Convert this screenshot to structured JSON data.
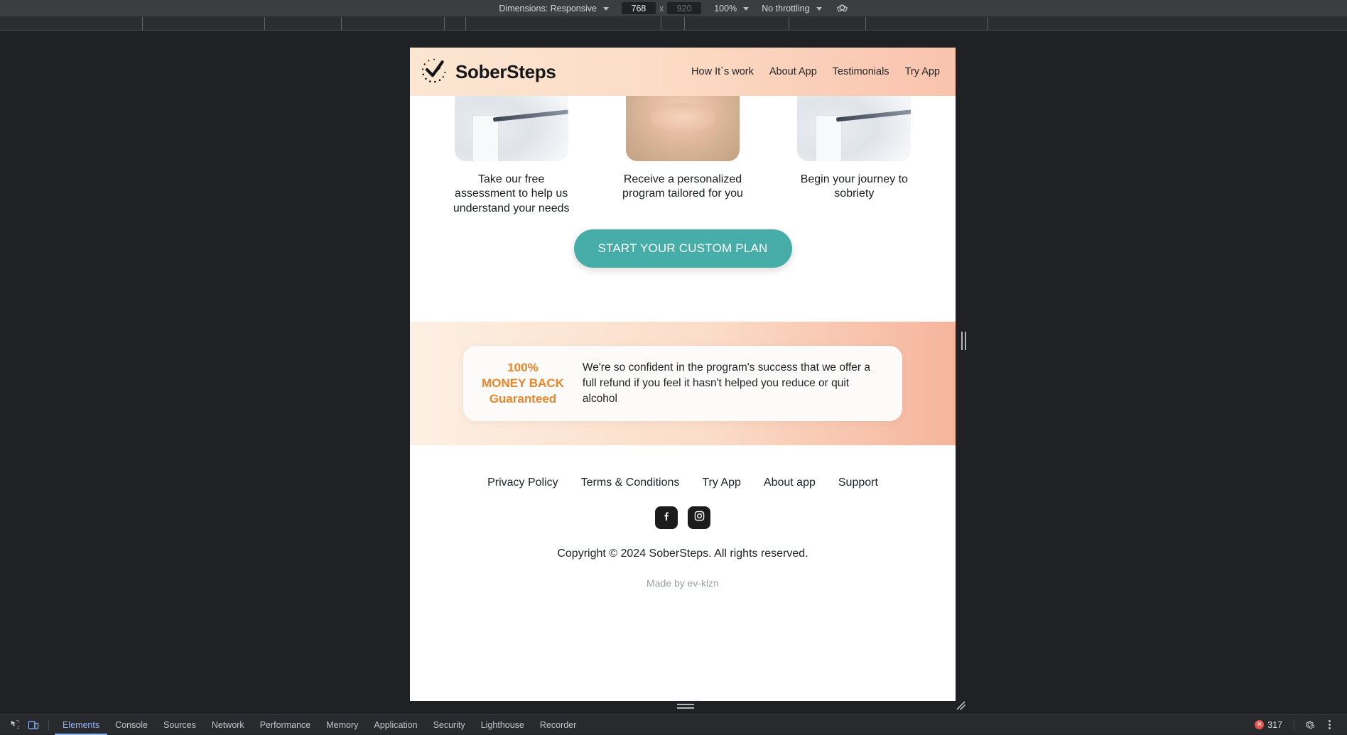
{
  "devtools_toolbar": {
    "dimensions_label": "Dimensions: Responsive",
    "width_value": "768",
    "height_placeholder": "920",
    "x_separator": "x",
    "zoom_label": "100%",
    "throttling_label": "No throttling",
    "rotate_icon": "rotate-icon"
  },
  "ruler": {
    "ticks": [
      200,
      372,
      480,
      625,
      655,
      930,
      963,
      1110,
      1218,
      1390
    ]
  },
  "site": {
    "header": {
      "logo_icon": "dotted-circle-check-icon",
      "brand": "SoberSteps",
      "nav": [
        {
          "label": "How It`s work"
        },
        {
          "label": "About App"
        },
        {
          "label": "Testimonials"
        },
        {
          "label": "Try App"
        }
      ]
    },
    "steps": [
      {
        "image": "laptop-photo",
        "text": "Take our free assessment to help us understand your needs"
      },
      {
        "image": "hands-photo",
        "text": "Receive a personalized program tailored for you"
      },
      {
        "image": "laptop-photo",
        "text": "Begin your journey to sobriety"
      }
    ],
    "cta": {
      "label": "START YOUR CUSTOM PLAN",
      "color": "#47ada8"
    },
    "guarantee": {
      "badge_line1": "100%",
      "badge_line2": "MONEY BACK",
      "badge_line3": "Guaranteed",
      "badge_color": "#e8862a",
      "copy": "We're so confident in the program's success that we offer a full refund if you feel it hasn't helped you reduce or quit alcohol"
    },
    "footer": {
      "links": [
        {
          "label": "Privacy Policy"
        },
        {
          "label": "Terms & Conditions"
        },
        {
          "label": "Try App"
        },
        {
          "label": "About app"
        },
        {
          "label": "Support"
        }
      ],
      "social": [
        {
          "icon": "facebook-icon",
          "name": "Facebook"
        },
        {
          "icon": "instagram-icon",
          "name": "Instagram"
        }
      ],
      "copyright": "Copyright © 2024 SoberSteps. All rights reserved.",
      "made_by": "Made by ev-klzn"
    }
  },
  "devtools_bottom": {
    "inspect_icon": "inspect-element-icon",
    "device_icon": "device-toolbar-icon",
    "tabs": [
      {
        "label": "Elements",
        "active": true
      },
      {
        "label": "Console",
        "active": false
      },
      {
        "label": "Sources",
        "active": false
      },
      {
        "label": "Network",
        "active": false
      },
      {
        "label": "Performance",
        "active": false
      },
      {
        "label": "Memory",
        "active": false
      },
      {
        "label": "Application",
        "active": false
      },
      {
        "label": "Security",
        "active": false
      },
      {
        "label": "Lighthouse",
        "active": false
      },
      {
        "label": "Recorder",
        "active": false
      }
    ],
    "error_count": "317",
    "error_color": "#e2534b",
    "settings_icon": "gear-icon",
    "more_icon": "kebab-menu-icon"
  }
}
